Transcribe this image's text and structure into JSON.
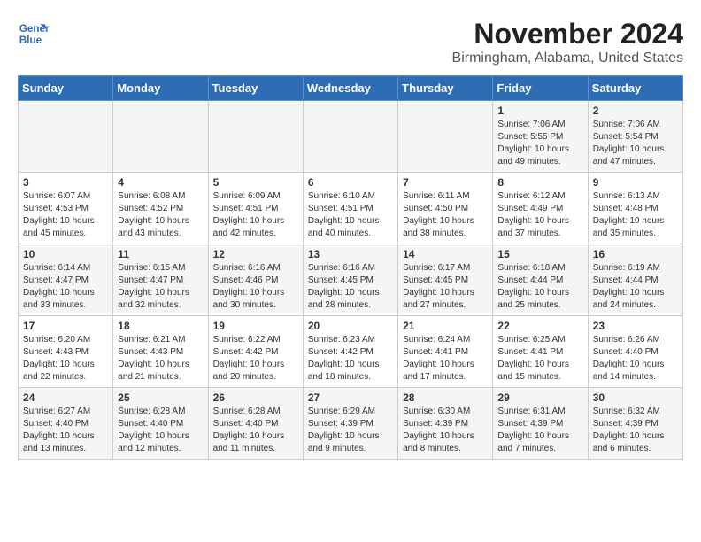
{
  "logo": {
    "line1": "General",
    "line2": "Blue"
  },
  "title": "November 2024",
  "subtitle": "Birmingham, Alabama, United States",
  "days_of_week": [
    "Sunday",
    "Monday",
    "Tuesday",
    "Wednesday",
    "Thursday",
    "Friday",
    "Saturday"
  ],
  "weeks": [
    [
      {
        "day": "",
        "info": ""
      },
      {
        "day": "",
        "info": ""
      },
      {
        "day": "",
        "info": ""
      },
      {
        "day": "",
        "info": ""
      },
      {
        "day": "",
        "info": ""
      },
      {
        "day": "1",
        "info": "Sunrise: 7:06 AM\nSunset: 5:55 PM\nDaylight: 10 hours\nand 49 minutes."
      },
      {
        "day": "2",
        "info": "Sunrise: 7:06 AM\nSunset: 5:54 PM\nDaylight: 10 hours\nand 47 minutes."
      }
    ],
    [
      {
        "day": "3",
        "info": "Sunrise: 6:07 AM\nSunset: 4:53 PM\nDaylight: 10 hours\nand 45 minutes."
      },
      {
        "day": "4",
        "info": "Sunrise: 6:08 AM\nSunset: 4:52 PM\nDaylight: 10 hours\nand 43 minutes."
      },
      {
        "day": "5",
        "info": "Sunrise: 6:09 AM\nSunset: 4:51 PM\nDaylight: 10 hours\nand 42 minutes."
      },
      {
        "day": "6",
        "info": "Sunrise: 6:10 AM\nSunset: 4:51 PM\nDaylight: 10 hours\nand 40 minutes."
      },
      {
        "day": "7",
        "info": "Sunrise: 6:11 AM\nSunset: 4:50 PM\nDaylight: 10 hours\nand 38 minutes."
      },
      {
        "day": "8",
        "info": "Sunrise: 6:12 AM\nSunset: 4:49 PM\nDaylight: 10 hours\nand 37 minutes."
      },
      {
        "day": "9",
        "info": "Sunrise: 6:13 AM\nSunset: 4:48 PM\nDaylight: 10 hours\nand 35 minutes."
      }
    ],
    [
      {
        "day": "10",
        "info": "Sunrise: 6:14 AM\nSunset: 4:47 PM\nDaylight: 10 hours\nand 33 minutes."
      },
      {
        "day": "11",
        "info": "Sunrise: 6:15 AM\nSunset: 4:47 PM\nDaylight: 10 hours\nand 32 minutes."
      },
      {
        "day": "12",
        "info": "Sunrise: 6:16 AM\nSunset: 4:46 PM\nDaylight: 10 hours\nand 30 minutes."
      },
      {
        "day": "13",
        "info": "Sunrise: 6:16 AM\nSunset: 4:45 PM\nDaylight: 10 hours\nand 28 minutes."
      },
      {
        "day": "14",
        "info": "Sunrise: 6:17 AM\nSunset: 4:45 PM\nDaylight: 10 hours\nand 27 minutes."
      },
      {
        "day": "15",
        "info": "Sunrise: 6:18 AM\nSunset: 4:44 PM\nDaylight: 10 hours\nand 25 minutes."
      },
      {
        "day": "16",
        "info": "Sunrise: 6:19 AM\nSunset: 4:44 PM\nDaylight: 10 hours\nand 24 minutes."
      }
    ],
    [
      {
        "day": "17",
        "info": "Sunrise: 6:20 AM\nSunset: 4:43 PM\nDaylight: 10 hours\nand 22 minutes."
      },
      {
        "day": "18",
        "info": "Sunrise: 6:21 AM\nSunset: 4:43 PM\nDaylight: 10 hours\nand 21 minutes."
      },
      {
        "day": "19",
        "info": "Sunrise: 6:22 AM\nSunset: 4:42 PM\nDaylight: 10 hours\nand 20 minutes."
      },
      {
        "day": "20",
        "info": "Sunrise: 6:23 AM\nSunset: 4:42 PM\nDaylight: 10 hours\nand 18 minutes."
      },
      {
        "day": "21",
        "info": "Sunrise: 6:24 AM\nSunset: 4:41 PM\nDaylight: 10 hours\nand 17 minutes."
      },
      {
        "day": "22",
        "info": "Sunrise: 6:25 AM\nSunset: 4:41 PM\nDaylight: 10 hours\nand 15 minutes."
      },
      {
        "day": "23",
        "info": "Sunrise: 6:26 AM\nSunset: 4:40 PM\nDaylight: 10 hours\nand 14 minutes."
      }
    ],
    [
      {
        "day": "24",
        "info": "Sunrise: 6:27 AM\nSunset: 4:40 PM\nDaylight: 10 hours\nand 13 minutes."
      },
      {
        "day": "25",
        "info": "Sunrise: 6:28 AM\nSunset: 4:40 PM\nDaylight: 10 hours\nand 12 minutes."
      },
      {
        "day": "26",
        "info": "Sunrise: 6:28 AM\nSunset: 4:40 PM\nDaylight: 10 hours\nand 11 minutes."
      },
      {
        "day": "27",
        "info": "Sunrise: 6:29 AM\nSunset: 4:39 PM\nDaylight: 10 hours\nand 9 minutes."
      },
      {
        "day": "28",
        "info": "Sunrise: 6:30 AM\nSunset: 4:39 PM\nDaylight: 10 hours\nand 8 minutes."
      },
      {
        "day": "29",
        "info": "Sunrise: 6:31 AM\nSunset: 4:39 PM\nDaylight: 10 hours\nand 7 minutes."
      },
      {
        "day": "30",
        "info": "Sunrise: 6:32 AM\nSunset: 4:39 PM\nDaylight: 10 hours\nand 6 minutes."
      }
    ]
  ]
}
